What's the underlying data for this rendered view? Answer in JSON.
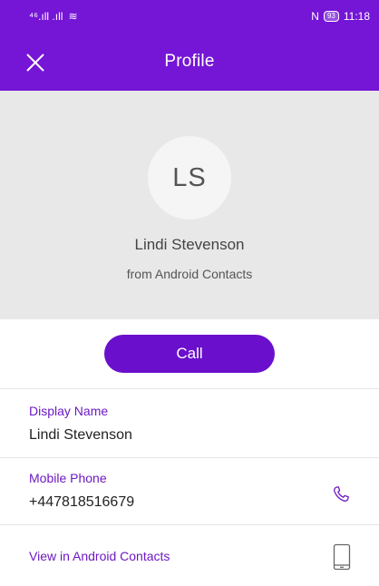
{
  "status_bar": {
    "signal_left": "⁴⁶.ıll .ıll",
    "wifi_text": "≋",
    "nfc": "N",
    "battery_level": "93",
    "time": "11:18"
  },
  "toolbar": {
    "title": "Profile",
    "close_icon": "close-icon"
  },
  "profile": {
    "initials": "LS",
    "name": "Lindi Stevenson",
    "source": "from Android Contacts"
  },
  "actions": {
    "call_label": "Call"
  },
  "fields": {
    "display_name_label": "Display Name",
    "display_name_value": "Lindi Stevenson",
    "mobile_label": "Mobile Phone",
    "mobile_value": "+447818516679",
    "view_contacts_label": "View in Android Contacts"
  },
  "colors": {
    "primary": "#7515d6",
    "label": "#6d19c2",
    "header_bg": "#e8e8e8"
  }
}
